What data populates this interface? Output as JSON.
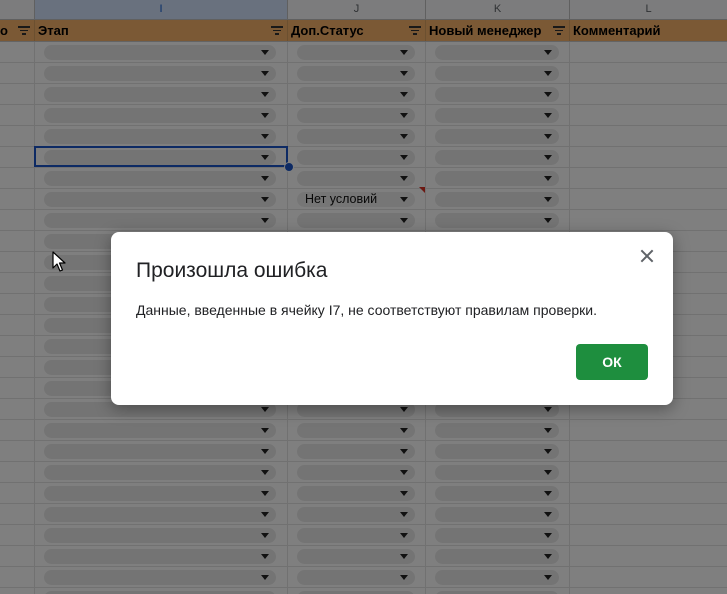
{
  "columns": {
    "letters": [
      "I",
      "J",
      "K",
      "L"
    ],
    "headers": [
      "о",
      "Этап",
      "Доп.Статус",
      "Новый менеджер",
      "Комментарий"
    ]
  },
  "grid": {
    "special_value": "Нет условий"
  },
  "dialog": {
    "title": "Произошла ошибка",
    "message": "Данные, введенные в ячейку I7, не соответствуют правилам проверки.",
    "ok_label": "ОК"
  },
  "icons": {
    "close": "close-icon",
    "filter": "filter-icon",
    "dropdown": "chevron-down-icon",
    "cursor": "mouse-pointer-icon"
  },
  "colors": {
    "header_bg": "#f6b26b",
    "ok_button": "#1e8e3e",
    "selection": "#1a55c8"
  }
}
